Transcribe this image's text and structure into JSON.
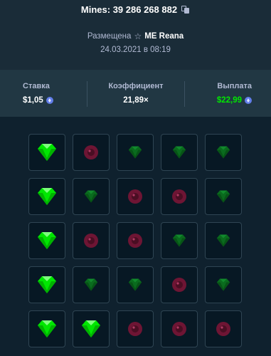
{
  "game": {
    "title": "Mines: 39 286 268 882",
    "placed_prefix": "Размещена",
    "username": "ME Reana",
    "date": "24.03.2021 в 08:19"
  },
  "stats": {
    "bet_label": "Ставка",
    "bet_value": "$1,05",
    "multiplier_label": "Коэффициент",
    "multiplier_value": "21,89×",
    "payout_label": "Выплата",
    "payout_value": "$22,99"
  },
  "colors": {
    "payout_green": "#00e701",
    "gem_bright": "#00e701",
    "gem_dim": "#0a6b1e",
    "mine_dim": "#6e1534",
    "coin": "#627eea"
  },
  "icons": {
    "copy": "copy-icon",
    "star": "star-icon",
    "coin": "ethereum-coin-icon",
    "gem": "gem-icon",
    "mine": "mine-icon"
  },
  "board": {
    "rows": 5,
    "cols": 5,
    "tiles": [
      [
        "gem-found",
        "mine",
        "gem",
        "gem",
        "gem"
      ],
      [
        "gem-found",
        "gem",
        "mine",
        "mine",
        "gem"
      ],
      [
        "gem-found",
        "mine",
        "mine",
        "gem",
        "gem"
      ],
      [
        "gem-found",
        "gem",
        "gem",
        "mine",
        "gem"
      ],
      [
        "gem-found",
        "gem-found",
        "mine",
        "mine",
        "mine"
      ]
    ]
  }
}
